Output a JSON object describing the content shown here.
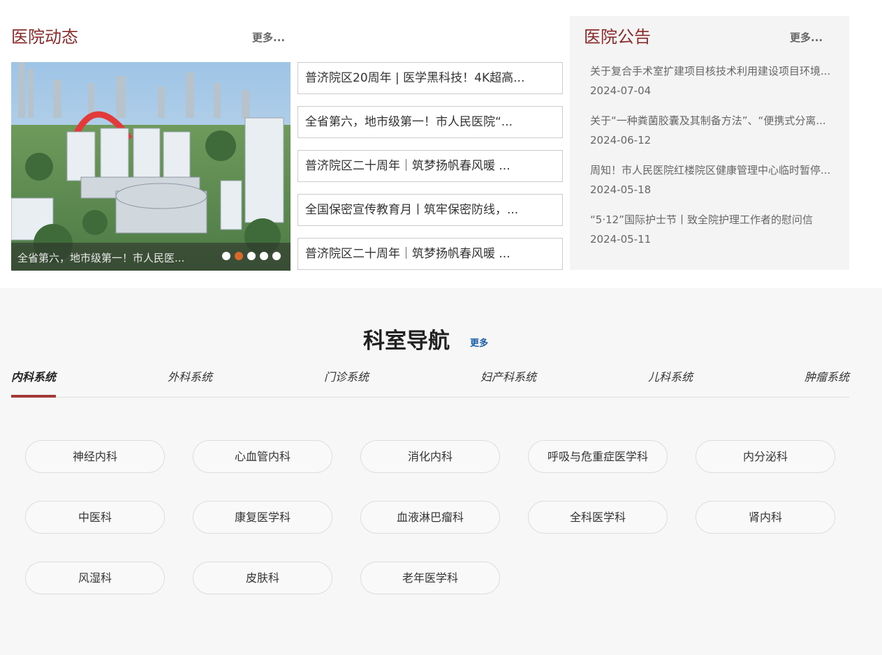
{
  "news": {
    "title": "医院动态",
    "more": "更多...",
    "carousel_caption": "全省第六，地市级第一！市人民医...",
    "dots": [
      false,
      true,
      false,
      false,
      false
    ],
    "items": [
      "普济院区20周年 | 医学黑科技！4K超高...",
      "全省第六，地市级第一！市人民医院“...",
      "普济院区二十周年｜筑梦扬帆春风暖 ...",
      "全国保密宣传教育月丨筑牢保密防线，...",
      "普济院区二十周年｜筑梦扬帆春风暖 ..."
    ]
  },
  "notice": {
    "title": "医院公告",
    "more": "更多...",
    "items": [
      {
        "text": "关于复合手术室扩建项目核技术利用建设项目环境...",
        "date": "2024-07-04"
      },
      {
        "text": "关于“一种粪菌胶囊及其制备方法”、“便携式分离...",
        "date": "2024-06-12"
      },
      {
        "text": "周知！市人民医院红楼院区健康管理中心临时暂停...",
        "date": "2024-05-18"
      },
      {
        "text": "“5·12”国际护士节丨致全院护理工作者的慰问信",
        "date": "2024-05-11"
      }
    ]
  },
  "departments": {
    "title": "科室导航",
    "more": "更多",
    "tabs": [
      "内科系统",
      "外科系统",
      "门诊系统",
      "妇产科系统",
      "儿科系统",
      "肿瘤系统"
    ],
    "active_tab": "内科系统",
    "items": [
      "神经内科",
      "心血管内科",
      "消化内科",
      "呼吸与危重症医学科",
      "内分泌科",
      "中医科",
      "康复医学科",
      "血液淋巴瘤科",
      "全科医学科",
      "肾内科",
      "风湿科",
      "皮肤科",
      "老年医学科"
    ]
  },
  "colors": {
    "brand_red": "#8b2a2a",
    "tab_underline": "#a33a3a",
    "dot_active": "#d9692b",
    "link_blue": "#1a5fa8"
  }
}
